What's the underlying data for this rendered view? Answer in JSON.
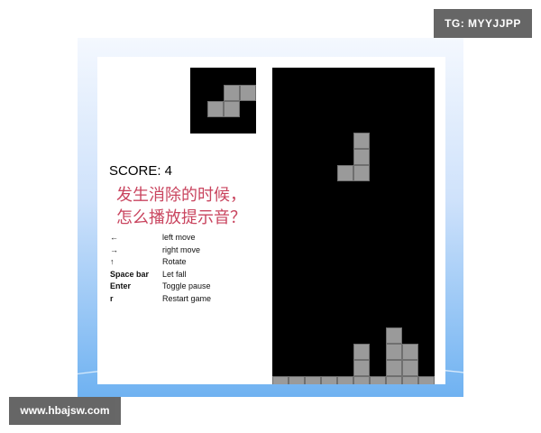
{
  "score": {
    "text": "SCORE: 4"
  },
  "question": {
    "line1": "发生消除的时候，",
    "line2": "怎么播放提示音？"
  },
  "controls": [
    {
      "key": "←",
      "action": "left move"
    },
    {
      "key": "→",
      "action": "right move"
    },
    {
      "key": "↑",
      "action": "Rotate"
    },
    {
      "key": "Space bar",
      "action": "Let fall"
    },
    {
      "key": "Enter",
      "action": "Toggle pause"
    },
    {
      "key": "r",
      "action": "Restart game"
    }
  ],
  "next_piece": {
    "shape": "S",
    "color": "#9a9a9a",
    "cells": [
      [
        1,
        0
      ],
      [
        2,
        0
      ],
      [
        0,
        1
      ],
      [
        1,
        1
      ]
    ]
  },
  "board": {
    "columns": 10,
    "rows": 19.5,
    "background": "#000000",
    "block_color": "#9a9a9a",
    "falling_piece": {
      "shape": "J",
      "cells": [
        [
          5,
          4
        ],
        [
          5,
          5
        ],
        [
          4,
          6
        ],
        [
          5,
          6
        ]
      ]
    },
    "settled_cells": [
      [
        7,
        16
      ],
      [
        5,
        17
      ],
      [
        7,
        17
      ],
      [
        8,
        17
      ],
      [
        5,
        18
      ],
      [
        7,
        18
      ],
      [
        8,
        18
      ],
      [
        0,
        19
      ],
      [
        1,
        19
      ],
      [
        2,
        19
      ],
      [
        3,
        19
      ],
      [
        4,
        19
      ],
      [
        5,
        19
      ],
      [
        6,
        19
      ],
      [
        7,
        19
      ],
      [
        8,
        19
      ],
      [
        9,
        19
      ]
    ]
  },
  "watermarks": {
    "top_right": "TG: MYYJJPP",
    "bottom_left": "www.hbajsw.com"
  }
}
